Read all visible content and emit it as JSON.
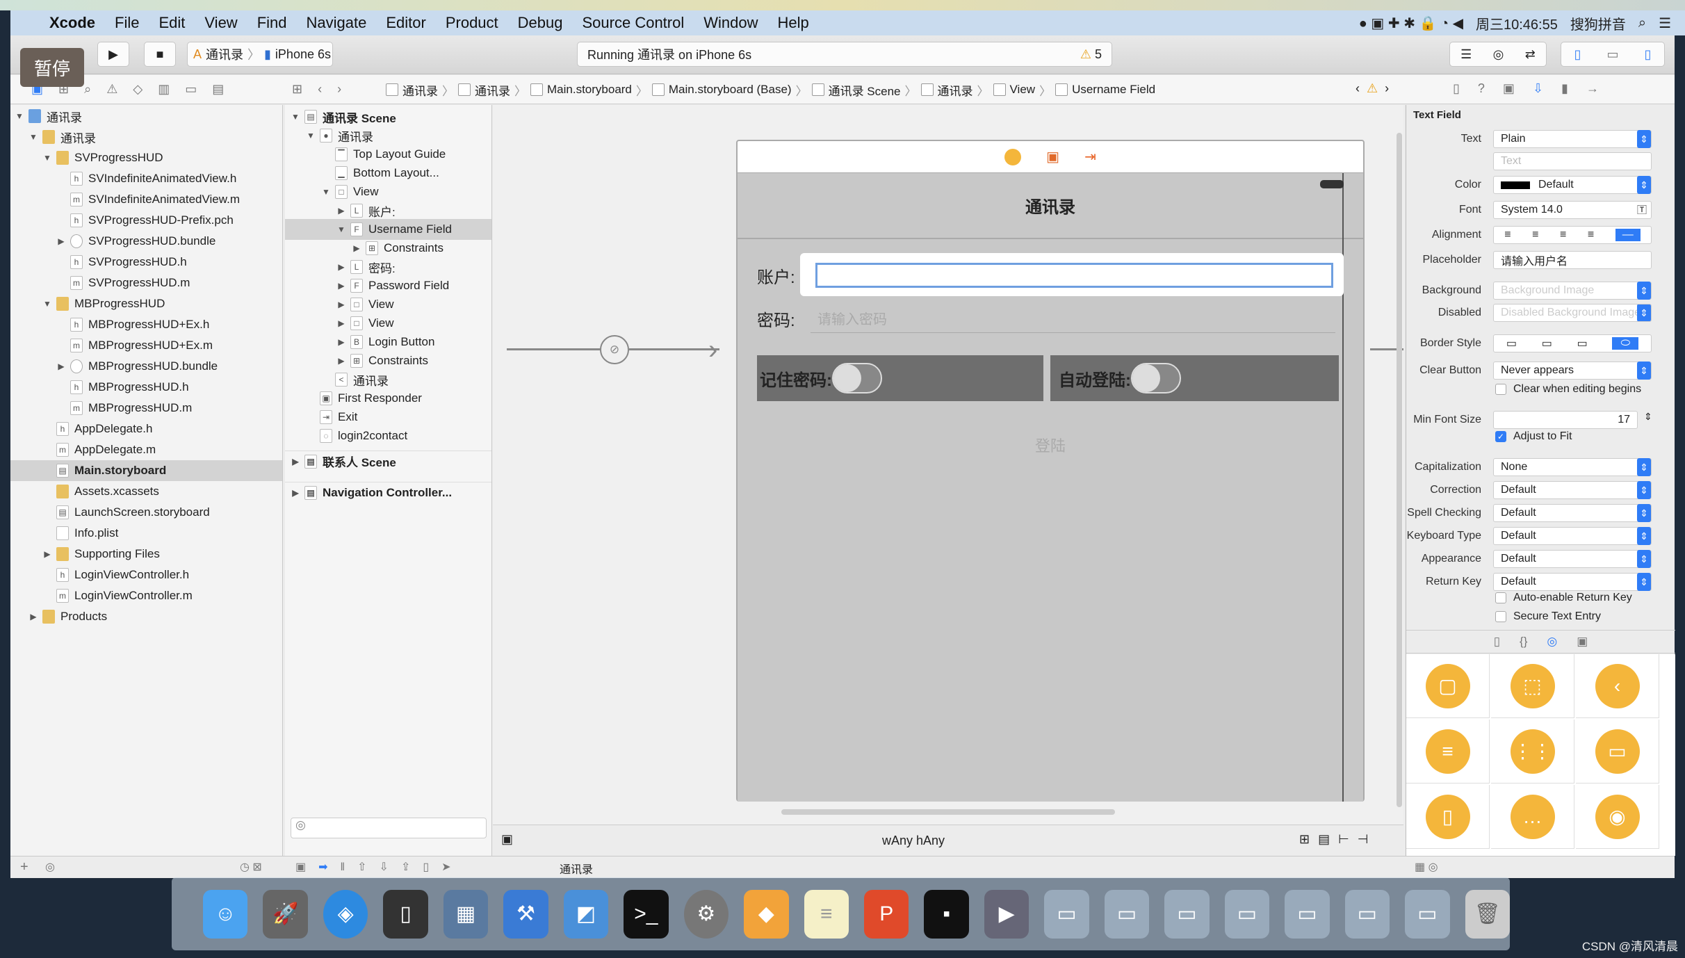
{
  "menubar": {
    "app": "Xcode",
    "items": [
      "File",
      "Edit",
      "View",
      "Find",
      "Navigate",
      "Editor",
      "Product",
      "Debug",
      "Source Control",
      "Window",
      "Help"
    ],
    "clock": "周三10:46:55",
    "input_method": "搜狗拼音"
  },
  "toolbar": {
    "pause_overlay": "暂停",
    "scheme": "通讯录",
    "device": "iPhone 6s",
    "activity": "Running 通讯录 on iPhone 6s",
    "warnings": "5"
  },
  "jumpbar": {
    "crumbs": [
      "通讯录",
      "通讯录",
      "Main.storyboard",
      "Main.storyboard (Base)",
      "通讯录 Scene",
      "通讯录",
      "View",
      "Username Field"
    ]
  },
  "navigator": {
    "items": [
      {
        "label": "通讯录",
        "level": 0,
        "type": "proj",
        "tri": "▼"
      },
      {
        "label": "通讯录",
        "level": 1,
        "type": "folder",
        "tri": "▼"
      },
      {
        "label": "SVProgressHUD",
        "level": 2,
        "type": "folder",
        "tri": "▼"
      },
      {
        "label": "SVIndefiniteAnimatedView.h",
        "level": 3,
        "type": "h"
      },
      {
        "label": "SVIndefiniteAnimatedView.m",
        "level": 3,
        "type": "m"
      },
      {
        "label": "SVProgressHUD-Prefix.pch",
        "level": 3,
        "type": "h"
      },
      {
        "label": "SVProgressHUD.bundle",
        "level": 3,
        "type": "bundle",
        "tri": "▶"
      },
      {
        "label": "SVProgressHUD.h",
        "level": 3,
        "type": "h"
      },
      {
        "label": "SVProgressHUD.m",
        "level": 3,
        "type": "m"
      },
      {
        "label": "MBProgressHUD",
        "level": 2,
        "type": "folder",
        "tri": "▼"
      },
      {
        "label": "MBProgressHUD+Ex.h",
        "level": 3,
        "type": "h"
      },
      {
        "label": "MBProgressHUD+Ex.m",
        "level": 3,
        "type": "m"
      },
      {
        "label": "MBProgressHUD.bundle",
        "level": 3,
        "type": "bundle",
        "tri": "▶"
      },
      {
        "label": "MBProgressHUD.h",
        "level": 3,
        "type": "h"
      },
      {
        "label": "MBProgressHUD.m",
        "level": 3,
        "type": "m"
      },
      {
        "label": "AppDelegate.h",
        "level": 2,
        "type": "h"
      },
      {
        "label": "AppDelegate.m",
        "level": 2,
        "type": "m"
      },
      {
        "label": "Main.storyboard",
        "level": 2,
        "type": "sb",
        "selected": true
      },
      {
        "label": "Assets.xcassets",
        "level": 2,
        "type": "folder"
      },
      {
        "label": "LaunchScreen.storyboard",
        "level": 2,
        "type": "sb"
      },
      {
        "label": "Info.plist",
        "level": 2,
        "type": "file"
      },
      {
        "label": "Supporting Files",
        "level": 2,
        "type": "folder",
        "tri": "▶"
      },
      {
        "label": "LoginViewController.h",
        "level": 2,
        "type": "h"
      },
      {
        "label": "LoginViewController.m",
        "level": 2,
        "type": "m"
      },
      {
        "label": "Products",
        "level": 1,
        "type": "folder",
        "tri": "▶"
      }
    ]
  },
  "outline": {
    "items": [
      {
        "label": "通讯录 Scene",
        "level": 0,
        "tri": "▼",
        "icon": "▤",
        "bold": true
      },
      {
        "label": "通讯录",
        "level": 1,
        "tri": "▼",
        "icon": "●"
      },
      {
        "label": "Top Layout Guide",
        "level": 2,
        "icon": "▔"
      },
      {
        "label": "Bottom Layout...",
        "level": 2,
        "icon": "▁"
      },
      {
        "label": "View",
        "level": 2,
        "tri": "▼",
        "icon": "□"
      },
      {
        "label": "账户:",
        "level": 3,
        "tri": "▶",
        "icon": "L"
      },
      {
        "label": "Username Field",
        "level": 3,
        "tri": "▼",
        "icon": "F",
        "selected": true
      },
      {
        "label": "Constraints",
        "level": 4,
        "tri": "▶",
        "icon": "⊞"
      },
      {
        "label": "密码:",
        "level": 3,
        "tri": "▶",
        "icon": "L"
      },
      {
        "label": "Password Field",
        "level": 3,
        "tri": "▶",
        "icon": "F"
      },
      {
        "label": "View",
        "level": 3,
        "tri": "▶",
        "icon": "□"
      },
      {
        "label": "View",
        "level": 3,
        "tri": "▶",
        "icon": "□"
      },
      {
        "label": "Login Button",
        "level": 3,
        "tri": "▶",
        "icon": "B"
      },
      {
        "label": "Constraints",
        "level": 3,
        "tri": "▶",
        "icon": "⊞"
      },
      {
        "label": "通讯录",
        "level": 2,
        "icon": "<"
      },
      {
        "label": "First Responder",
        "level": 1,
        "icon": "▣"
      },
      {
        "label": "Exit",
        "level": 1,
        "icon": "⇥"
      },
      {
        "label": "login2contact",
        "level": 1,
        "icon": "◌"
      }
    ],
    "other_scenes": [
      "联系人 Scene",
      "Navigation Controller..."
    ]
  },
  "canvas": {
    "nav_title": "通讯录",
    "account_label": "账户:",
    "password_label": "密码:",
    "password_placeholder": "请输入密码",
    "remember_label": "记住密码:",
    "autologin_label": "自动登陆:",
    "login_button": "登陆",
    "size_class": "wAny hAny"
  },
  "inspector": {
    "section": "Text Field",
    "text_label": "Text",
    "text_value": "Plain",
    "text_placeholder": "Text",
    "color_label": "Color",
    "color_value": "Default",
    "color_swatch": "#000000",
    "font_label": "Font",
    "font_value": "System 14.0",
    "alignment_label": "Alignment",
    "placeholder_label": "Placeholder",
    "placeholder_value": "请输入用户名",
    "background_label": "Background",
    "background_placeholder": "Background Image",
    "disabled_label": "Disabled",
    "disabled_placeholder": "Disabled Background Image",
    "border_label": "Border Style",
    "clear_label": "Clear Button",
    "clear_value": "Never appears",
    "clear_editing": "Clear when editing begins",
    "minfont_label": "Min Font Size",
    "minfont_value": "17",
    "adjust": "Adjust to Fit",
    "popups": [
      {
        "label": "Capitalization",
        "value": "None"
      },
      {
        "label": "Correction",
        "value": "Default"
      },
      {
        "label": "Spell Checking",
        "value": "Default"
      },
      {
        "label": "Keyboard Type",
        "value": "Default"
      },
      {
        "label": "Appearance",
        "value": "Default"
      },
      {
        "label": "Return Key",
        "value": "Default"
      }
    ],
    "auto_return": "Auto-enable Return Key",
    "secure": "Secure Text Entry"
  },
  "bottombar": {
    "scene_label": "通讯录"
  },
  "watermark": "CSDN @清风清晨",
  "colors": {
    "accent": "#2f7cf6",
    "library": "#f4b63b"
  }
}
